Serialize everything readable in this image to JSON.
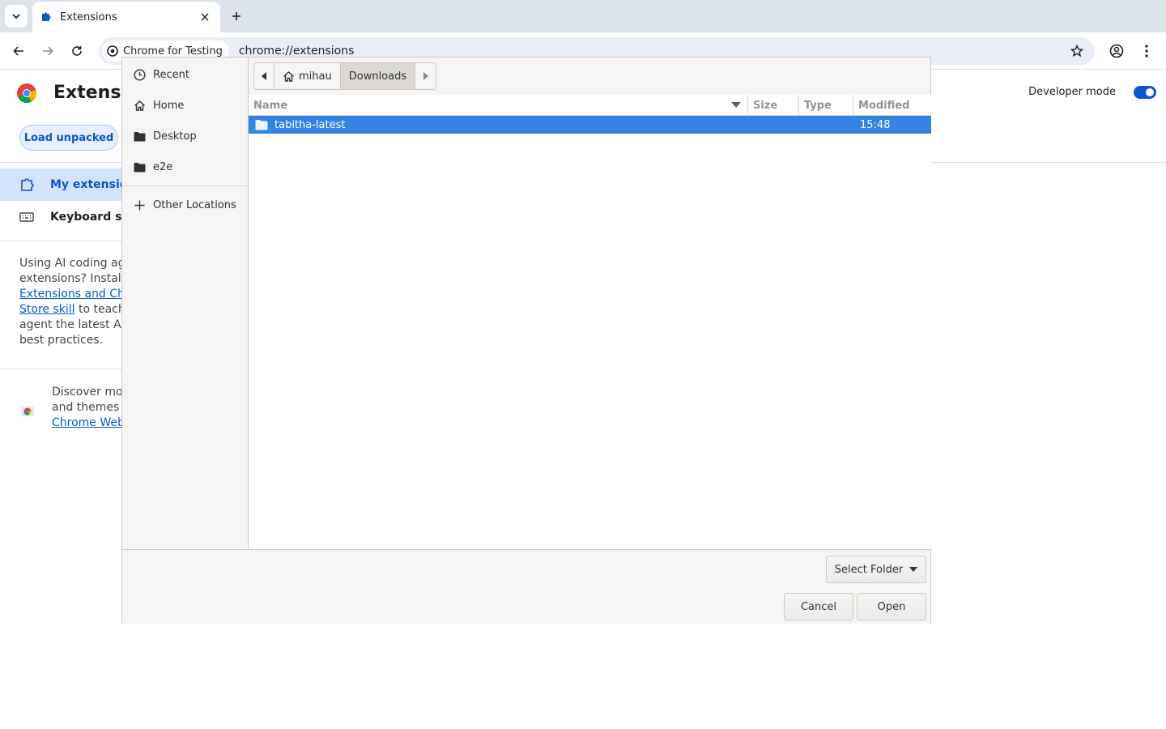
{
  "browser": {
    "tab_title": "Extensions",
    "site_chip": "Chrome for Testing",
    "url": "chrome://extensions"
  },
  "extensions_page": {
    "title": "Extensio",
    "developer_mode_label": "Developer mode",
    "developer_mode_on": true,
    "load_unpacked_label": "Load unpacked",
    "nav": [
      {
        "label": "My extensions",
        "active": true
      },
      {
        "label": "Keyboard sho",
        "active": false
      }
    ],
    "ai_promo": {
      "line1": "Using AI coding ager",
      "line2": "extensions? Install tl",
      "link1": "Extensions and Chro",
      "link2": "Store skill",
      "line3": " to teach y",
      "line4": "agent the latest API",
      "line5": "best practices."
    },
    "discover": {
      "line1": "Discover more",
      "line2": "and themes o",
      "link": "Chrome Web S"
    }
  },
  "file_dialog": {
    "places": [
      {
        "label": "Recent",
        "icon": "clock-icon"
      },
      {
        "label": "Home",
        "icon": "home-icon"
      },
      {
        "label": "Desktop",
        "icon": "folder-icon"
      },
      {
        "label": "e2e",
        "icon": "folder-icon"
      },
      {
        "label": "Other Locations",
        "icon": "plus-icon"
      }
    ],
    "path": {
      "home": "mihau",
      "current": "Downloads"
    },
    "columns": {
      "name": "Name",
      "size": "Size",
      "type": "Type",
      "modified": "Modified"
    },
    "rows": [
      {
        "name": "tabitha-latest",
        "size": "",
        "type": "",
        "modified": "15:48",
        "selected": true
      }
    ],
    "filter_label": "Select Folder",
    "cancel_label": "Cancel",
    "open_label": "Open"
  },
  "colors": {
    "selection": "#3584e4",
    "accent": "#0b57d0",
    "tabstrip": "#dde3ea"
  }
}
